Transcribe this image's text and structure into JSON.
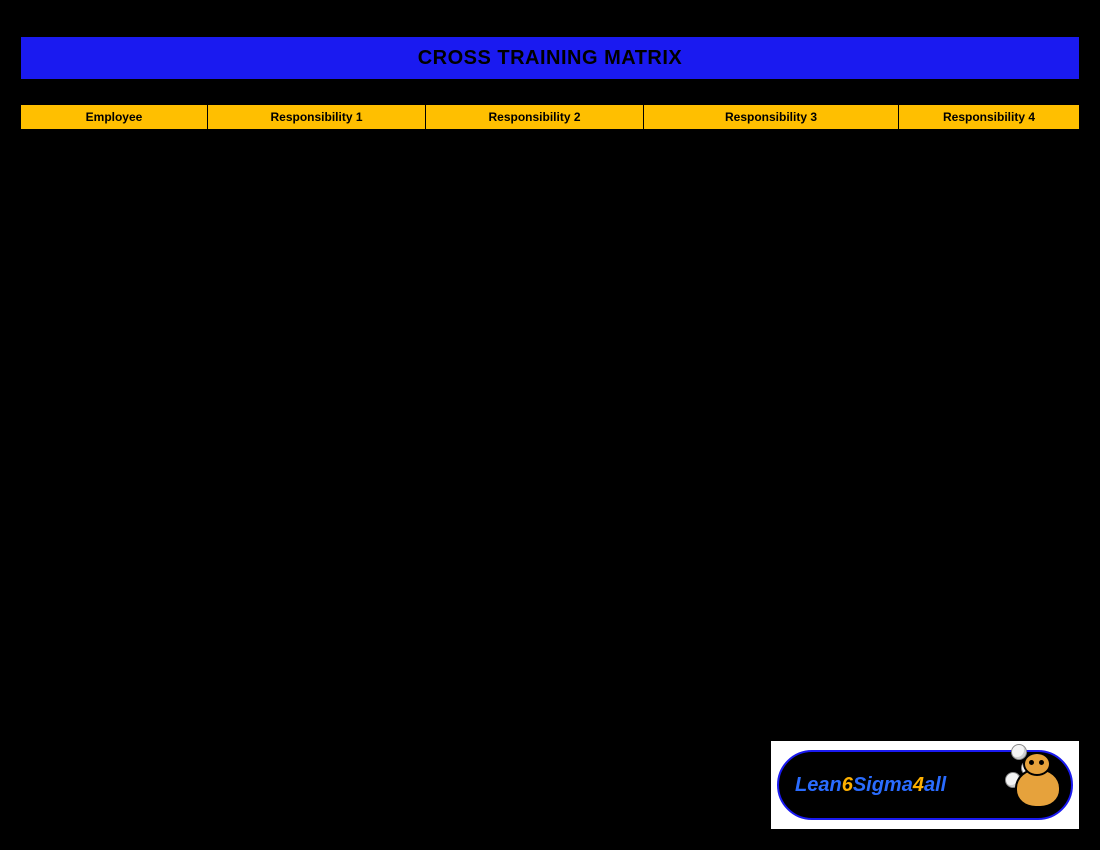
{
  "title": "CROSS TRAINING MATRIX",
  "columns": {
    "employee": "Employee",
    "r1": "Responsibility 1",
    "r2": "Responsibility 2",
    "r3": "Responsibility 3",
    "r4": "Responsibility 4"
  },
  "logo": {
    "p1": "Lean",
    "p2": "6",
    "p3": "Sigma",
    "p4": "4",
    "p5": "all"
  },
  "colors": {
    "title_bg": "#1a1af0",
    "header_bg": "#ffbf00",
    "page_bg": "#000000"
  }
}
